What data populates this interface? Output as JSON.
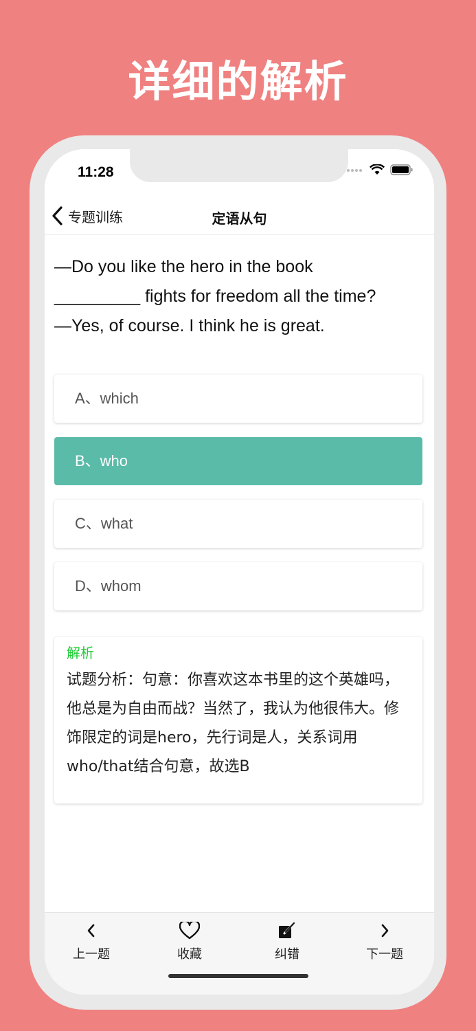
{
  "headline": "详细的解析",
  "status_bar": {
    "time": "11:28"
  },
  "nav": {
    "back_label": "专题训练",
    "title": "定语从句"
  },
  "question": {
    "lines": [
      "—Do you like the hero in the book",
      "_________ fights for freedom all the time?",
      "—Yes, of course. I think he is great."
    ]
  },
  "options": [
    {
      "label": "A、which",
      "selected": false
    },
    {
      "label": "B、who",
      "selected": true
    },
    {
      "label": "C、what",
      "selected": false
    },
    {
      "label": "D、whom",
      "selected": false
    }
  ],
  "analysis": {
    "title": "解析",
    "body": "试题分析：句意：你喜欢这本书里的这个英雄吗，他总是为自由而战？当然了，我认为他很伟大。修饰限定的词是hero，先行词是人，关系词用who/that结合句意，故选B"
  },
  "tabbar": {
    "prev_label": "上一题",
    "favorite_label": "收藏",
    "report_label": "纠错",
    "next_label": "下一题"
  },
  "colors": {
    "background": "#EF8180",
    "selected_option": "#5BBBA9",
    "analysis_title": "#1DCB34"
  },
  "icons": [
    "chevron-left-icon",
    "heart-icon",
    "edit-icon",
    "chevron-right-icon",
    "wifi-icon",
    "battery-icon",
    "signal-icon"
  ]
}
